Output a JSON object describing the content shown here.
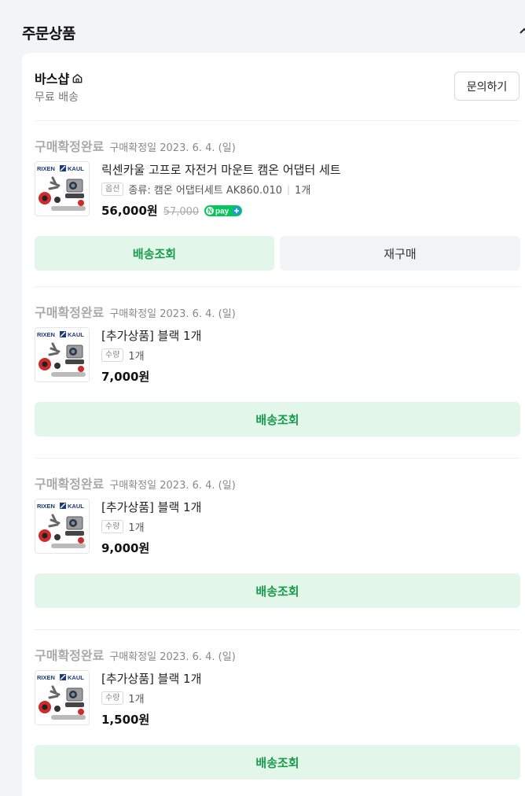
{
  "section": {
    "title": "주문상품",
    "collapse_icon": "chevron-up-icon"
  },
  "store": {
    "name": "바스샵",
    "home_icon": "home-icon",
    "shipping": "무료 배송",
    "inquiry_label": "문의하기"
  },
  "brand_logo_text": [
    "RIXEN",
    "KAUL"
  ],
  "npay_badge": "npay+",
  "orders": [
    {
      "status": "구매확정완료",
      "confirm_date": "구매확정일 2023. 6. 4. (일)",
      "product_name": "릭센카울 고프로 자전거 마운트 캠온 어댑터 세트",
      "option_tag": "옵션",
      "option_value": "종류: 캠온 어댑터세트 AK860.010",
      "quantity": "1개",
      "price": "56,000원",
      "original_price": "57,000",
      "buttons": [
        "배송조회",
        "재구매"
      ]
    },
    {
      "status": "구매확정완료",
      "confirm_date": "구매확정일 2023. 6. 4. (일)",
      "product_name": "[추가상품] 블랙 1개",
      "option_tag": "수량",
      "quantity": "1개",
      "price": "7,000원",
      "buttons": [
        "배송조회"
      ]
    },
    {
      "status": "구매확정완료",
      "confirm_date": "구매확정일 2023. 6. 4. (일)",
      "product_name": "[추가상품] 블랙 1개",
      "option_tag": "수량",
      "quantity": "1개",
      "price": "9,000원",
      "buttons": [
        "배송조회"
      ]
    },
    {
      "status": "구매확정완료",
      "confirm_date": "구매확정일 2023. 6. 4. (일)",
      "product_name": "[추가상품] 블랙 1개",
      "option_tag": "수량",
      "quantity": "1개",
      "price": "1,500원",
      "buttons": [
        "배송조회"
      ]
    }
  ],
  "colors": {
    "accent_green": "#1a9c4d",
    "green_button_bg": "#e3f6ea",
    "status_gray": "#aaaaaa",
    "page_bg": "#f3f4f6"
  }
}
